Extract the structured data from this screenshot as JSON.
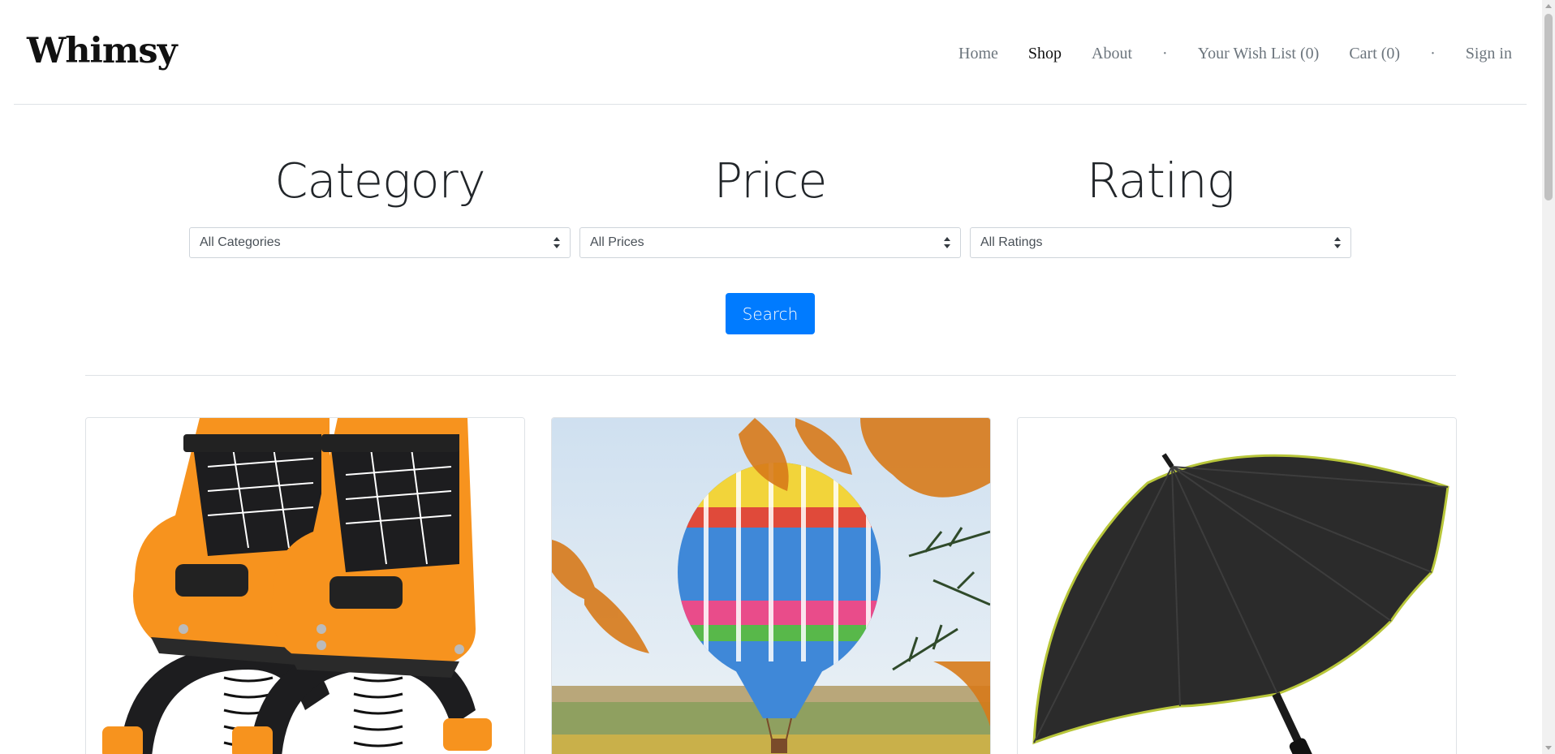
{
  "brand": {
    "name": "Whimsy"
  },
  "nav": {
    "home": "Home",
    "shop": "Shop",
    "about": "About",
    "separator": "·",
    "wishlist": "Your Wish List (0)",
    "cart": "Cart (0)",
    "signin": "Sign in",
    "active": "Shop"
  },
  "filters": {
    "category": {
      "title": "Category",
      "selected": "All Categories"
    },
    "price": {
      "title": "Price",
      "selected": "All Prices"
    },
    "rating": {
      "title": "Rating",
      "selected": "All Ratings"
    }
  },
  "search_button": "Search",
  "products": [
    {
      "image": "orange-jumping-shoes"
    },
    {
      "image": "hot-air-balloon"
    },
    {
      "image": "black-umbrella"
    }
  ],
  "colors": {
    "accent": "#007bff",
    "border": "#dee2e6"
  }
}
